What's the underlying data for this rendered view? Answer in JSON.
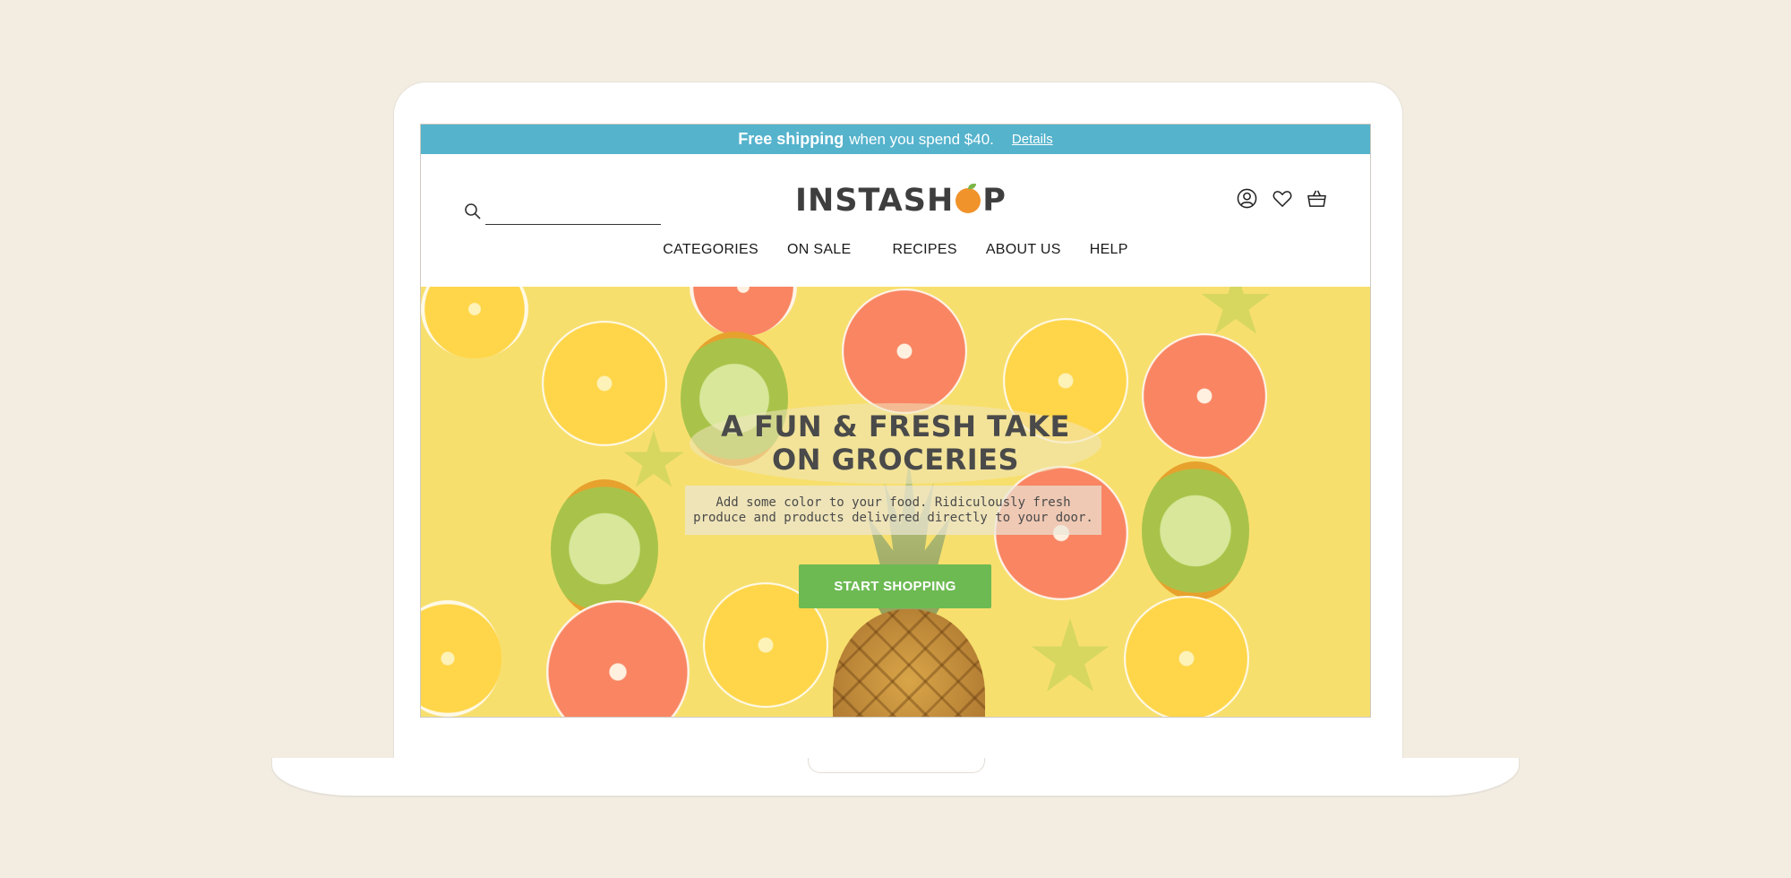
{
  "promo": {
    "strong": "Free shipping",
    "text": "when you spend $40.",
    "link": "Details"
  },
  "header": {
    "logo_prefix": "INSTASH",
    "logo_suffix": "P",
    "search_placeholder": ""
  },
  "nav": {
    "items": [
      {
        "label": "CATEGORIES"
      },
      {
        "label": "ON SALE"
      },
      {
        "label": "RECIPES"
      },
      {
        "label": "ABOUT US"
      },
      {
        "label": "HELP"
      }
    ]
  },
  "hero": {
    "title_line1": "A FUN & FRESH TAKE",
    "title_line2": "ON GROCERIES",
    "subtitle": "Add some color to your food. Ridiculously fresh produce and products delivered directly to your door.",
    "cta": "START SHOPPING"
  },
  "icons": [
    "search-icon",
    "account-icon",
    "wishlist-heart-icon",
    "cart-basket-icon"
  ],
  "colors": {
    "promo_bar": "#55b3cc",
    "cta": "#6dba53",
    "logo_orange": "#f0932b",
    "background": "#f2ece1"
  }
}
